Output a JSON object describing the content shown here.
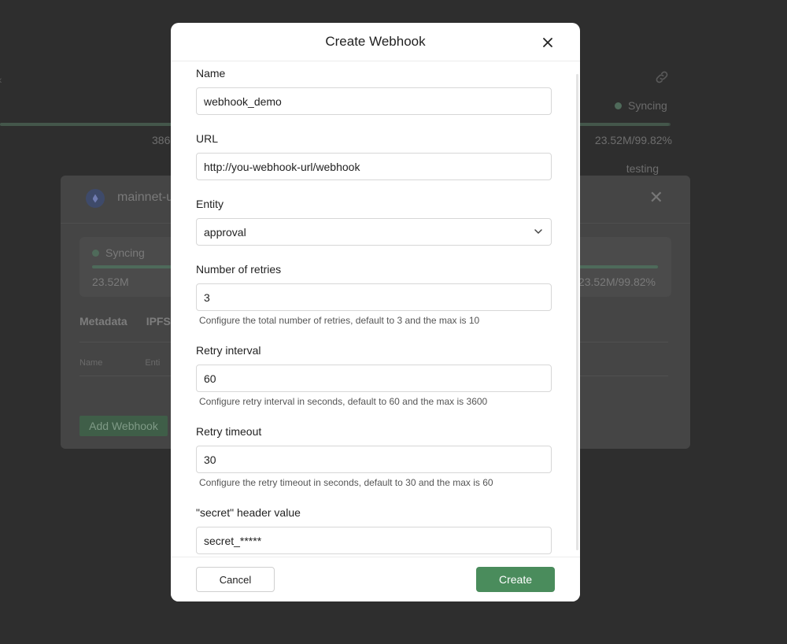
{
  "background": {
    "status_label": "Syncing",
    "top_progress_fraction": 0.9982,
    "top_number_left": "386",
    "top_number_right": "23.52M/99.82%",
    "testing_label": "testing",
    "panel": {
      "title": "mainnet-u",
      "card": {
        "status_label": "Syncing",
        "progress_fraction": 0.9982,
        "number_left": "23.52M",
        "number_right": "23.52M/99.82%"
      },
      "tabs": [
        "Metadata",
        "IPFS"
      ],
      "table_headers": [
        "Name",
        "Enti"
      ],
      "add_webhook_label": "Add Webhook"
    }
  },
  "modal": {
    "title": "Create Webhook",
    "fields": {
      "name": {
        "label": "Name",
        "value": "webhook_demo"
      },
      "url": {
        "label": "URL",
        "value": "http://you-webhook-url/webhook"
      },
      "entity": {
        "label": "Entity",
        "value": "approval"
      },
      "retries": {
        "label": "Number of retries",
        "value": "3",
        "help": "Configure the total number of retries, default to 3 and the max is 10"
      },
      "retry_interval": {
        "label": "Retry interval",
        "value": "60",
        "help": "Configure retry interval in seconds, default to 60 and the max is 3600"
      },
      "retry_timeout": {
        "label": "Retry timeout",
        "value": "30",
        "help": "Configure the retry timeout in seconds, default to 30 and the max is 60"
      },
      "secret": {
        "label": "\"secret\" header value",
        "value": "secret_*****"
      }
    },
    "footer": {
      "cancel_label": "Cancel",
      "create_label": "Create"
    }
  },
  "colors": {
    "primary_button": "#4a8c5c",
    "overlay": "#2e2e2e"
  },
  "icons": [
    "chevron-left-icon",
    "link-icon",
    "ethereum-logo-icon",
    "close-icon",
    "chevron-down-icon"
  ]
}
